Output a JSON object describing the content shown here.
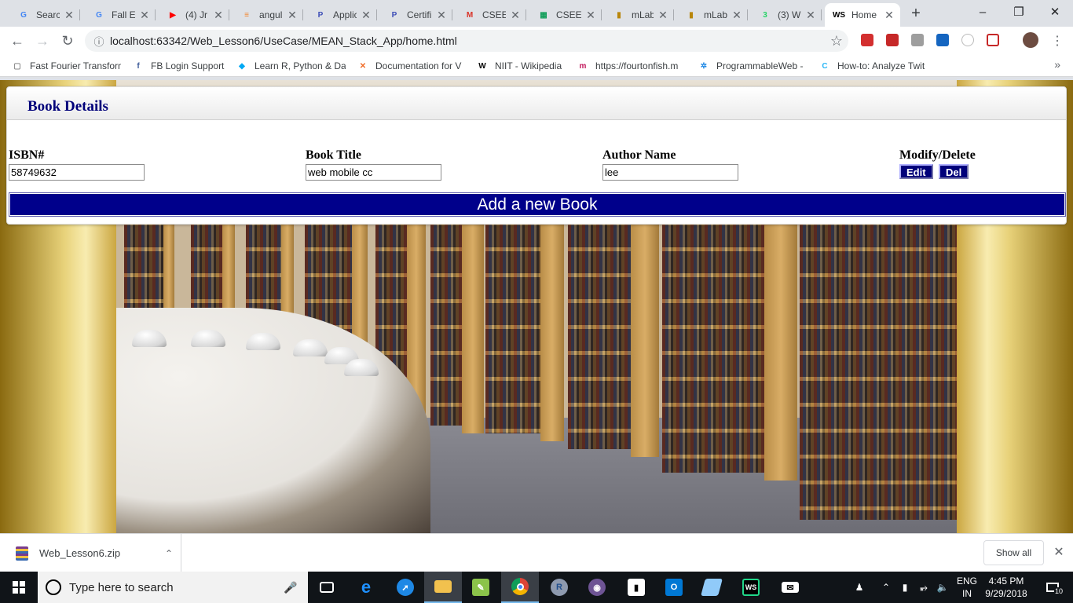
{
  "browser": {
    "tabs": [
      {
        "label": "Search",
        "icon": "google-icon",
        "color": "#4285f4",
        "glyph": "G",
        "active": false
      },
      {
        "label": "Fall Ed",
        "icon": "google-icon",
        "color": "#4285f4",
        "glyph": "G",
        "active": false
      },
      {
        "label": "(4) Jr",
        "icon": "youtube-icon",
        "color": "#ff0000",
        "glyph": "▶",
        "active": false
      },
      {
        "label": "angul",
        "icon": "stackoverflow-icon",
        "color": "#f48024",
        "glyph": "≡",
        "active": false
      },
      {
        "label": "Applic",
        "icon": "pega-icon",
        "color": "#3d4db7",
        "glyph": "P",
        "active": false
      },
      {
        "label": "Certifi",
        "icon": "pega-icon",
        "color": "#3d4db7",
        "glyph": "P",
        "active": false
      },
      {
        "label": "CSEE",
        "icon": "gmail-icon",
        "color": "#d93025",
        "glyph": "M",
        "active": false
      },
      {
        "label": "CSEE",
        "icon": "sheets-icon",
        "color": "#0f9d58",
        "glyph": "▦",
        "active": false
      },
      {
        "label": "mLab",
        "icon": "mlab-icon",
        "color": "#b8860b",
        "glyph": "▮",
        "active": false
      },
      {
        "label": "mLab",
        "icon": "mlab-icon",
        "color": "#b8860b",
        "glyph": "▮",
        "active": false
      },
      {
        "label": "(3) W",
        "icon": "whatsapp-icon",
        "color": "#25d366",
        "glyph": "3",
        "active": false
      },
      {
        "label": "Home",
        "icon": "webstorm-icon",
        "color": "#000000",
        "glyph": "WS",
        "active": true
      }
    ],
    "url": "localhost:63342/Web_Lesson6/UseCase/MEAN_Stack_App/home.html",
    "bookmarks": [
      {
        "label": "Fast Fourier Transform",
        "icon": "doc-icon",
        "color": "#888888",
        "glyph": "▢"
      },
      {
        "label": "FB Login Support",
        "icon": "facebook-icon",
        "color": "#3b5998",
        "glyph": "f"
      },
      {
        "label": "Learn R, Python & Da",
        "icon": "datacamp-icon",
        "color": "#03a9f4",
        "glyph": "◆"
      },
      {
        "label": "Documentation for V",
        "icon": "vscode-icon",
        "color": "#f06a25",
        "glyph": "✕"
      },
      {
        "label": "NIIT - Wikipedia",
        "icon": "wikipedia-icon",
        "color": "#000000",
        "glyph": "W"
      },
      {
        "label": "https://fourtonfish.m",
        "icon": "globe-icon",
        "color": "#c2185b",
        "glyph": "m"
      },
      {
        "label": "ProgrammableWeb -",
        "icon": "programmableweb-icon",
        "color": "#1e88e5",
        "glyph": "✲"
      },
      {
        "label": "How-to: Analyze Twit",
        "icon": "cloudera-icon",
        "color": "#29b6f6",
        "glyph": "C"
      }
    ]
  },
  "app": {
    "panel_title": "Book Details",
    "columns": {
      "isbn": "ISBN#",
      "title": "Book Title",
      "author": "Author Name",
      "actions": "Modify/Delete"
    },
    "row": {
      "isbn": "58749632",
      "title": "web mobile cc",
      "author": "lee"
    },
    "edit_label": "Edit",
    "delete_label": "Del",
    "add_label": "Add a new Book"
  },
  "downloads": {
    "file_name": "Web_Lesson6.zip",
    "show_all_label": "Show all"
  },
  "taskbar": {
    "search_placeholder": "Type here to search",
    "language": "ENG",
    "region": "IN",
    "time": "4:45 PM",
    "date": "9/29/2018",
    "notification_count": "10"
  }
}
